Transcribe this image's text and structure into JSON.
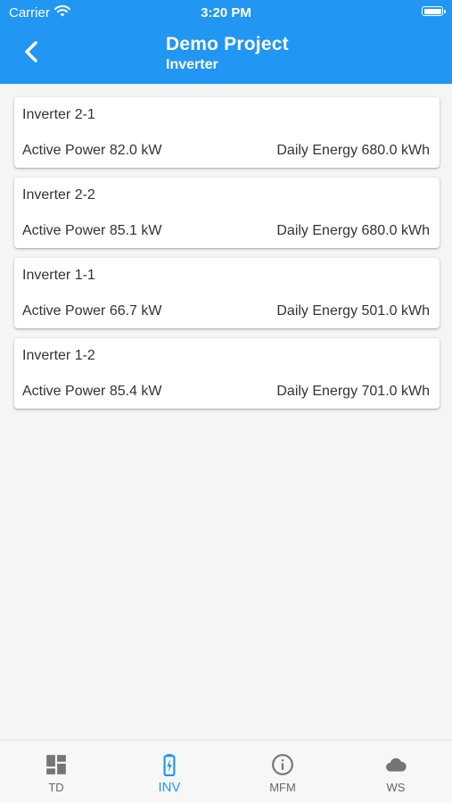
{
  "status_bar": {
    "carrier": "Carrier",
    "time": "3:20 PM"
  },
  "app_bar": {
    "title": "Demo Project",
    "subtitle": "Inverter"
  },
  "inverters": [
    {
      "name": "Inverter 2-1",
      "active_power": "Active Power 82.0 kW",
      "daily_energy": "Daily Energy 680.0 kWh"
    },
    {
      "name": "Inverter 2-2",
      "active_power": "Active Power 85.1 kW",
      "daily_energy": "Daily Energy 680.0 kWh"
    },
    {
      "name": "Inverter 1-1",
      "active_power": "Active Power 66.7 kW",
      "daily_energy": "Daily Energy 501.0 kWh"
    },
    {
      "name": "Inverter 1-2",
      "active_power": "Active Power 85.4 kW",
      "daily_energy": "Daily Energy 701.0 kWh"
    }
  ],
  "tabs": [
    {
      "label": "TD",
      "icon": "dashboard-icon"
    },
    {
      "label": "INV",
      "icon": "battery-charging-icon"
    },
    {
      "label": "MFM",
      "icon": "info-icon"
    },
    {
      "label": "WS",
      "icon": "cloud-icon"
    }
  ],
  "colors": {
    "primary": "#2196f3",
    "inactive": "#666666",
    "background": "#f5f5f5"
  }
}
